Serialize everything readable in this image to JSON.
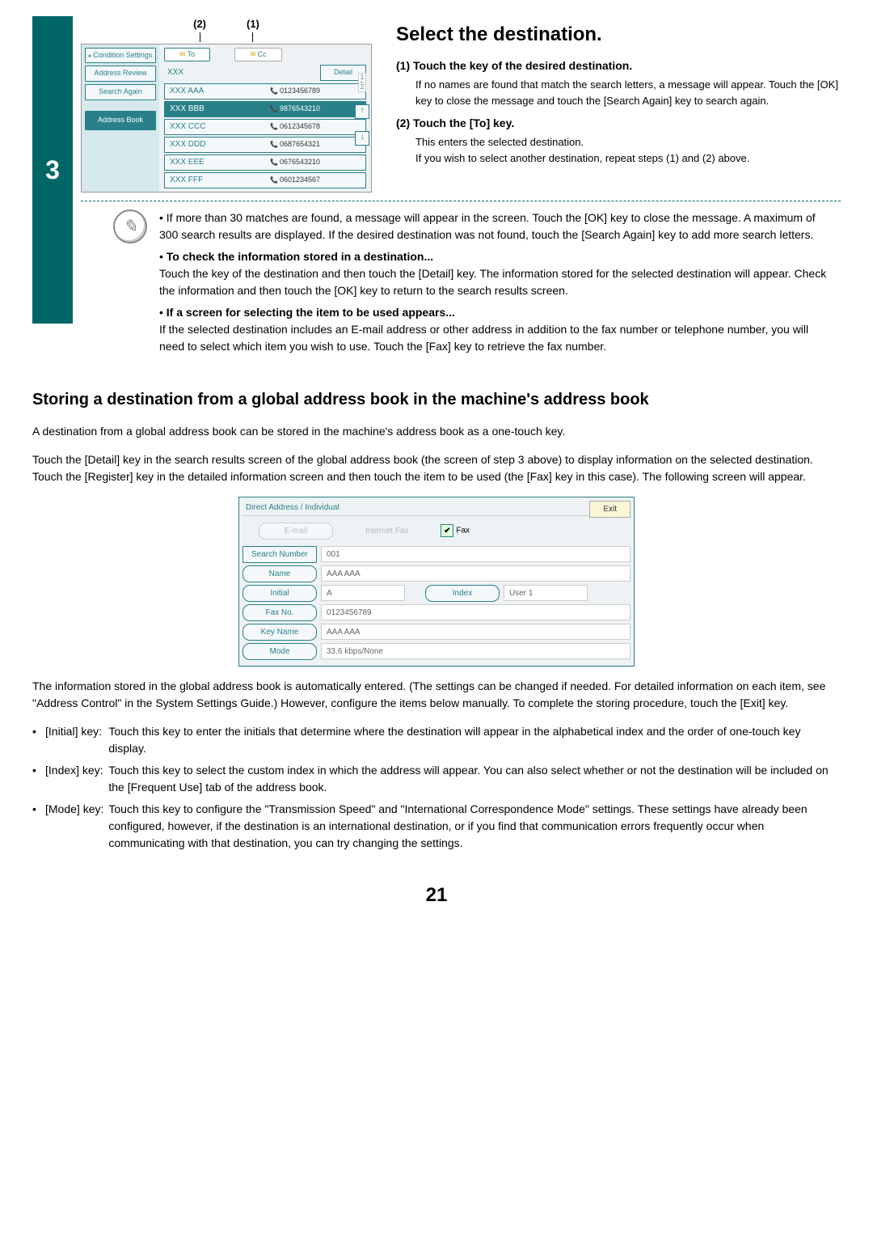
{
  "step_number": "3",
  "labels": {
    "l2": "(2)",
    "l1": "(1)"
  },
  "panel1": {
    "side": {
      "condition": "Condition Settings",
      "review": "Address Review",
      "again": "Search Again",
      "book": "Address Book"
    },
    "tabs": {
      "to": "To",
      "cc": "Cc"
    },
    "search": "XXX",
    "detail": "Detail",
    "page": {
      "cur": "1",
      "total": "2"
    },
    "items": [
      {
        "name": "XXX AAA",
        "phone": "0123456789"
      },
      {
        "name": "XXX BBB",
        "phone": "9876543210"
      },
      {
        "name": "XXX CCC",
        "phone": "0612345678"
      },
      {
        "name": "XXX DDD",
        "phone": "0687654321"
      },
      {
        "name": "XXX EEE",
        "phone": "0676543210"
      },
      {
        "name": "XXX FFF",
        "phone": "0601234567"
      }
    ]
  },
  "right": {
    "heading": "Select the destination.",
    "i1_title": "(1) Touch the key of the desired destination.",
    "i1_body": "If no names are found that match the search letters, a message will appear. Touch the [OK] key to close the message and touch the [Search Again] key to search again.",
    "i2_title": "(2) Touch the [To] key.",
    "i2_body1": "This enters the selected destination.",
    "i2_body2": "If you wish to select another destination, repeat steps (1) and (2) above."
  },
  "notes": {
    "n1": "If more than 30 matches are found, a message will appear in the screen. Touch the [OK] key to close the message. A maximum of 300 search results are displayed. If the desired destination was not found, touch the [Search Again] key to add more search letters.",
    "n2h": "To check the information stored in a destination...",
    "n2": "Touch the key of the destination and then touch the [Detail] key. The information stored for the selected destination will appear. Check the information and then touch the [OK] key to return to the search results screen.",
    "n3h": "If a screen for selecting the item to be used appears...",
    "n3": "If the selected destination includes an E-mail address or other address in addition to the fax number or telephone number, you will need to select which item you wish to use. Touch the [Fax] key to retrieve the fax number."
  },
  "section2": {
    "heading": "Storing a destination from a global address book in the machine's address book",
    "p1": "A destination from a global address book can be stored in the machine's address book as a one-touch key.",
    "p2": "Touch the [Detail] key in the search results screen of the global address book (the screen of step 3 above) to display information on the selected destination. Touch the [Register] key in the detailed information screen and then touch the item to be used (the [Fax] key in this case). The following screen will appear."
  },
  "panel2": {
    "title": "Direct Address / Individual",
    "exit": "Exit",
    "email": "E-mail",
    "ifax": "Internet Fax",
    "fax": "Fax",
    "rows": {
      "searchnum_l": "Search Number",
      "searchnum_v": "001",
      "name_l": "Name",
      "name_v": "AAA AAA",
      "initial_l": "Initial",
      "initial_v": "A",
      "index_l": "Index",
      "index_v": "User 1",
      "faxno_l": "Fax No.",
      "faxno_v": "0123456789",
      "keyname_l": "Key Name",
      "keyname_v": "AAA AAA",
      "mode_l": "Mode",
      "mode_v": "33.6 kbps/None"
    }
  },
  "para_after_panel": "The information stored in the global address book is automatically entered. (The settings can be changed if needed. For detailed information on each item, see \"Address Control\" in the System Settings Guide.) However, configure the items below manually. To complete the storing procedure, touch the [Exit] key.",
  "defs": {
    "k1": "[Initial] key:",
    "v1": "Touch this key to enter the initials that determine where the destination will appear in the alphabetical index and the order of one-touch key display.",
    "k2": "[Index] key:",
    "v2": "Touch this key to select the custom index in which the address will appear. You can also select whether or not the destination will be included on the [Frequent Use] tab of the address book.",
    "k3": "[Mode] key:",
    "v3": "Touch this key to configure the \"Transmission Speed\" and \"International Correspondence Mode\" settings. These settings have already been configured, however, if the destination is an international destination, or if you find that communication errors frequently occur when communicating with that destination, you can try changing the settings."
  },
  "page_number": "21"
}
